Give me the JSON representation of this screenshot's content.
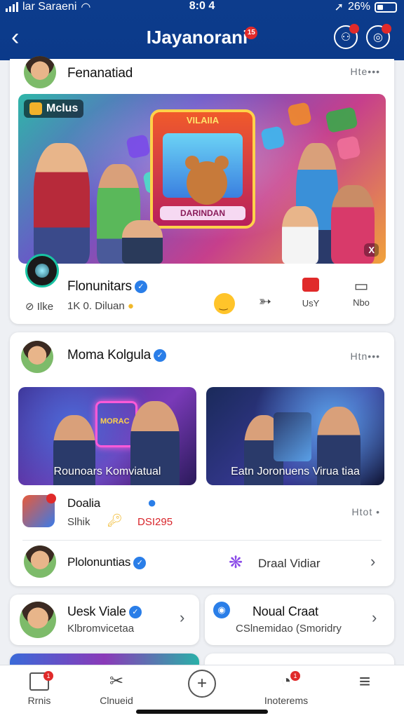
{
  "status": {
    "carrier": "lar Saraeni",
    "time": "8:0 4",
    "battery": "26%"
  },
  "header": {
    "title": "IJayanorani",
    "title_badge": "15"
  },
  "card1": {
    "author": "Fenanatiad",
    "more": "Hte•••",
    "hero_tag": "Mclus",
    "stage_top": "VILAIIA",
    "stage_bottom": "DARINDAN",
    "hero_corner": "X",
    "page_name": "Flonunitars",
    "like_label": "Ilke",
    "meta_text": "1K 0. Diluan",
    "act_comment": "UsY",
    "act_save": "Nbo"
  },
  "card2": {
    "author": "Moma Kolgula",
    "more": "Htn•••",
    "tile1_caption": "Rounoars Komviatual",
    "tile1_sign": "MORAC",
    "tile2_caption": "Eatn Joronuens Virua tiaa",
    "row1_title": "Doalia",
    "row1_sub": "Slhik",
    "row1_count": "DSI295",
    "row1_more": "Htot •",
    "row2_title": "Plolonuntias",
    "row2_action": "Draal Vidiar"
  },
  "card3": {
    "title": "Uesk Viale",
    "sub": "Klbromvicetaa"
  },
  "card4": {
    "title": "Noual Craat",
    "sub": "CSlnemidao (Smoridry"
  },
  "tabs": [
    {
      "label": "Rrnis",
      "badge": "1"
    },
    {
      "label": "Clnueid",
      "badge": ""
    },
    {
      "label": "",
      "badge": ""
    },
    {
      "label": "Inoterems",
      "badge": "1"
    },
    {
      "label": "",
      "badge": ""
    }
  ]
}
